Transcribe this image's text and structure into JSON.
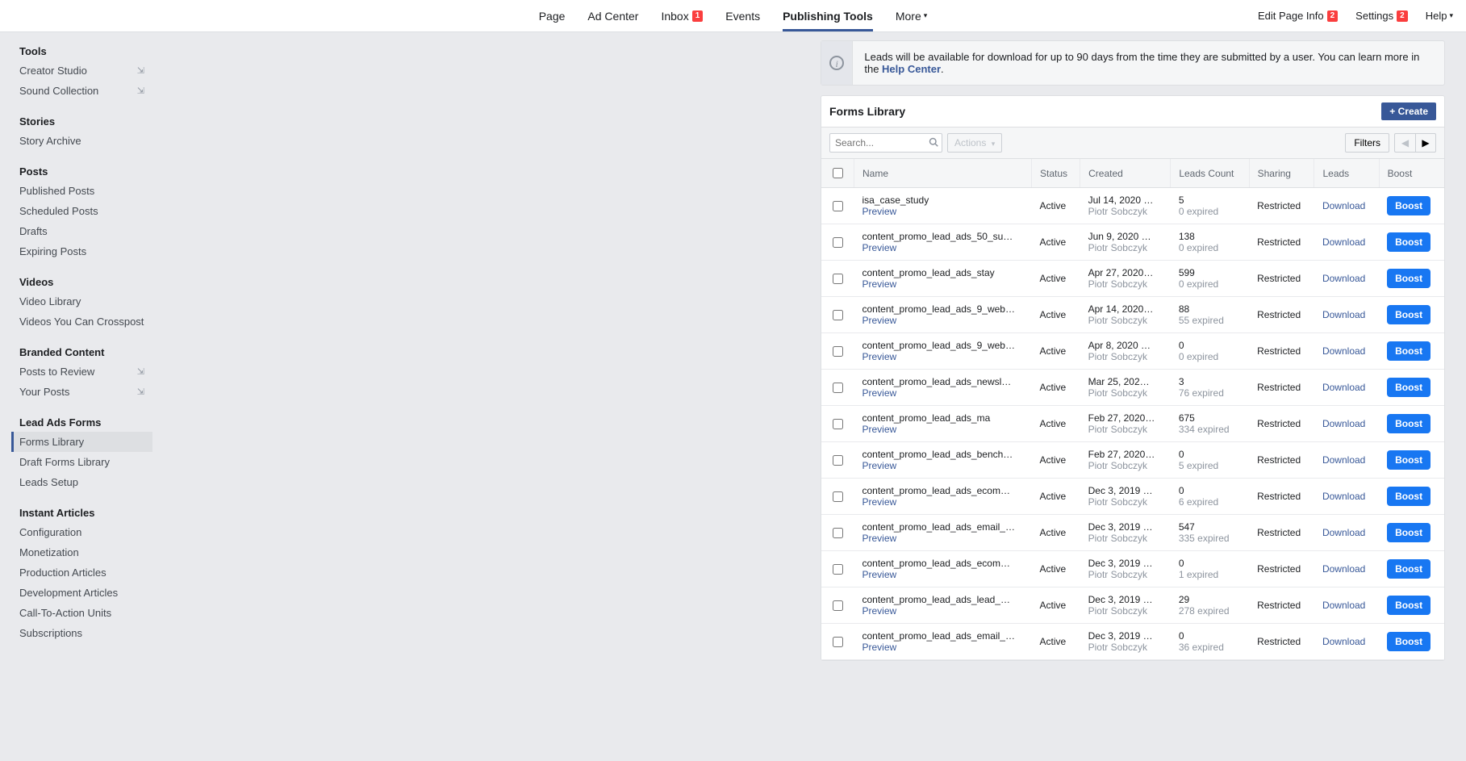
{
  "topnav": {
    "items": [
      {
        "label": "Page"
      },
      {
        "label": "Ad Center"
      },
      {
        "label": "Inbox",
        "badge": "1"
      },
      {
        "label": "Events"
      },
      {
        "label": "Publishing Tools",
        "active": true
      },
      {
        "label": "More",
        "caret": true
      }
    ],
    "right": [
      {
        "label": "Edit Page Info",
        "badge": "2"
      },
      {
        "label": "Settings",
        "badge": "2"
      },
      {
        "label": "Help",
        "caret": true
      }
    ]
  },
  "sidebar": [
    {
      "heading": "Tools",
      "items": [
        {
          "label": "Creator Studio",
          "ext": true
        },
        {
          "label": "Sound Collection",
          "ext": true
        }
      ]
    },
    {
      "heading": "Stories",
      "items": [
        {
          "label": "Story Archive"
        }
      ]
    },
    {
      "heading": "Posts",
      "items": [
        {
          "label": "Published Posts"
        },
        {
          "label": "Scheduled Posts"
        },
        {
          "label": "Drafts"
        },
        {
          "label": "Expiring Posts"
        }
      ]
    },
    {
      "heading": "Videos",
      "items": [
        {
          "label": "Video Library"
        },
        {
          "label": "Videos You Can Crosspost"
        }
      ]
    },
    {
      "heading": "Branded Content",
      "items": [
        {
          "label": "Posts to Review",
          "ext": true
        },
        {
          "label": "Your Posts",
          "ext": true
        }
      ]
    },
    {
      "heading": "Lead Ads Forms",
      "items": [
        {
          "label": "Forms Library",
          "selected": true
        },
        {
          "label": "Draft Forms Library"
        },
        {
          "label": "Leads Setup"
        }
      ]
    },
    {
      "heading": "Instant Articles",
      "items": [
        {
          "label": "Configuration"
        },
        {
          "label": "Monetization"
        },
        {
          "label": "Production Articles"
        },
        {
          "label": "Development Articles"
        },
        {
          "label": "Call-To-Action Units"
        },
        {
          "label": "Subscriptions"
        }
      ]
    }
  ],
  "info": {
    "text_a": "Leads will be available for download for up to 90 days from the time they are submitted by a user. You can learn more in the ",
    "link": "Help Center",
    "text_b": "."
  },
  "panel": {
    "title": "Forms Library",
    "create": "Create",
    "search_placeholder": "Search...",
    "actions": "Actions",
    "filters": "Filters"
  },
  "columns": {
    "name": "Name",
    "status": "Status",
    "created": "Created",
    "leads_count": "Leads Count",
    "sharing": "Sharing",
    "leads": "Leads",
    "boost": "Boost"
  },
  "row_labels": {
    "preview": "Preview",
    "download": "Download",
    "boost": "Boost"
  },
  "rows": [
    {
      "name": "isa_case_study",
      "status": "Active",
      "created": "Jul 14, 2020 …",
      "author": "Piotr Sobczyk",
      "count": "5",
      "expired": "0 expired",
      "sharing": "Restricted"
    },
    {
      "name": "content_promo_lead_ads_50_su…",
      "status": "Active",
      "created": "Jun 9, 2020 …",
      "author": "Piotr Sobczyk",
      "count": "138",
      "expired": "0 expired",
      "sharing": "Restricted"
    },
    {
      "name": "content_promo_lead_ads_stay",
      "status": "Active",
      "created": "Apr 27, 2020…",
      "author": "Piotr Sobczyk",
      "count": "599",
      "expired": "0 expired",
      "sharing": "Restricted"
    },
    {
      "name": "content_promo_lead_ads_9_web…",
      "status": "Active",
      "created": "Apr 14, 2020…",
      "author": "Piotr Sobczyk",
      "count": "88",
      "expired": "55 expired",
      "sharing": "Restricted"
    },
    {
      "name": "content_promo_lead_ads_9_web…",
      "status": "Active",
      "created": "Apr 8, 2020 …",
      "author": "Piotr Sobczyk",
      "count": "0",
      "expired": "0 expired",
      "sharing": "Restricted"
    },
    {
      "name": "content_promo_lead_ads_newsl…",
      "status": "Active",
      "created": "Mar 25, 202…",
      "author": "Piotr Sobczyk",
      "count": "3",
      "expired": "76 expired",
      "sharing": "Restricted"
    },
    {
      "name": "content_promo_lead_ads_ma",
      "status": "Active",
      "created": "Feb 27, 2020…",
      "author": "Piotr Sobczyk",
      "count": "675",
      "expired": "334 expired",
      "sharing": "Restricted"
    },
    {
      "name": "content_promo_lead_ads_bench…",
      "status": "Active",
      "created": "Feb 27, 2020…",
      "author": "Piotr Sobczyk",
      "count": "0",
      "expired": "5 expired",
      "sharing": "Restricted"
    },
    {
      "name": "content_promo_lead_ads_ecom…",
      "status": "Active",
      "created": "Dec 3, 2019 …",
      "author": "Piotr Sobczyk",
      "count": "0",
      "expired": "6 expired",
      "sharing": "Restricted"
    },
    {
      "name": "content_promo_lead_ads_email_…",
      "status": "Active",
      "created": "Dec 3, 2019 …",
      "author": "Piotr Sobczyk",
      "count": "547",
      "expired": "335 expired",
      "sharing": "Restricted"
    },
    {
      "name": "content_promo_lead_ads_ecom…",
      "status": "Active",
      "created": "Dec 3, 2019 …",
      "author": "Piotr Sobczyk",
      "count": "0",
      "expired": "1 expired",
      "sharing": "Restricted"
    },
    {
      "name": "content_promo_lead_ads_lead_…",
      "status": "Active",
      "created": "Dec 3, 2019 …",
      "author": "Piotr Sobczyk",
      "count": "29",
      "expired": "278 expired",
      "sharing": "Restricted"
    },
    {
      "name": "content_promo_lead_ads_email_…",
      "status": "Active",
      "created": "Dec 3, 2019 …",
      "author": "Piotr Sobczyk",
      "count": "0",
      "expired": "36 expired",
      "sharing": "Restricted"
    }
  ]
}
